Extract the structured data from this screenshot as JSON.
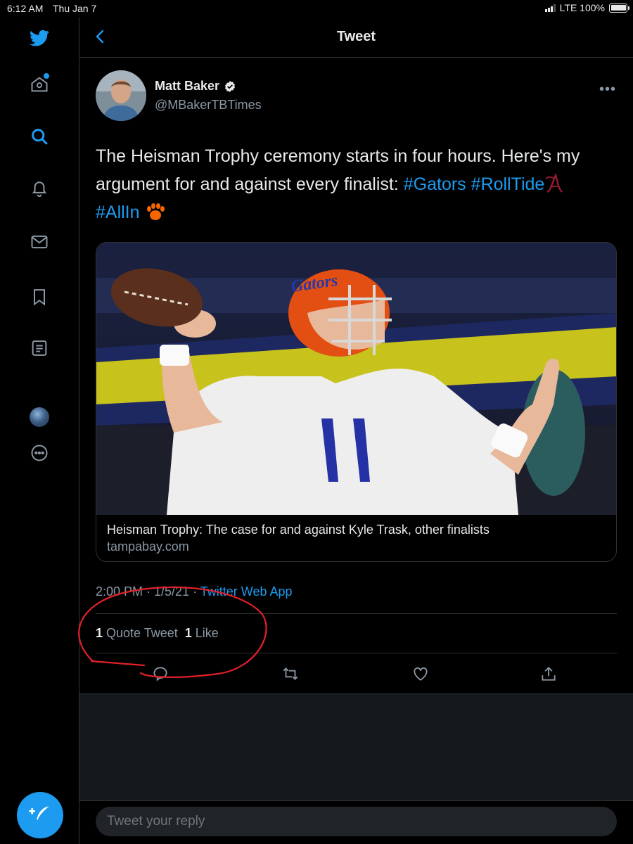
{
  "status_bar": {
    "time": "6:12 AM",
    "date": "Thu Jan 7",
    "network": "LTE 100%"
  },
  "sidebar": {
    "items": [
      {
        "icon": "twitter-bird-icon"
      },
      {
        "icon": "home-icon"
      },
      {
        "icon": "search-icon"
      },
      {
        "icon": "bell-icon"
      },
      {
        "icon": "mail-icon"
      },
      {
        "icon": "bookmark-icon"
      },
      {
        "icon": "list-icon"
      },
      {
        "icon": "profile-avatar"
      },
      {
        "icon": "more-icon"
      }
    ],
    "compose_icon": "compose-tweet-icon"
  },
  "header": {
    "title": "Tweet"
  },
  "tweet": {
    "author_name": "Matt Baker",
    "handle": "@MBakerTBTimes",
    "text_part1": "The Heisman Trophy ceremony starts in four hours. Here's my argument for and against every finalist:",
    "hashtag1": "#Gators",
    "hashtag2": "#RollTide",
    "hashtag3": "#AllIn",
    "card": {
      "title": "Heisman Trophy: The case for and against Kyle Trask, other finalists",
      "domain": "tampabay.com"
    },
    "timestamp": "2:00 PM · 1/5/21 ·",
    "source_app": "Twitter Web App",
    "stats": {
      "quote_count": "1",
      "quote_label": "Quote Tweet",
      "like_count": "1",
      "like_label": "Like"
    }
  },
  "reply": {
    "placeholder": "Tweet your reply"
  },
  "colors": {
    "accent": "#1d9bf0",
    "annotation": "#e0202a"
  }
}
